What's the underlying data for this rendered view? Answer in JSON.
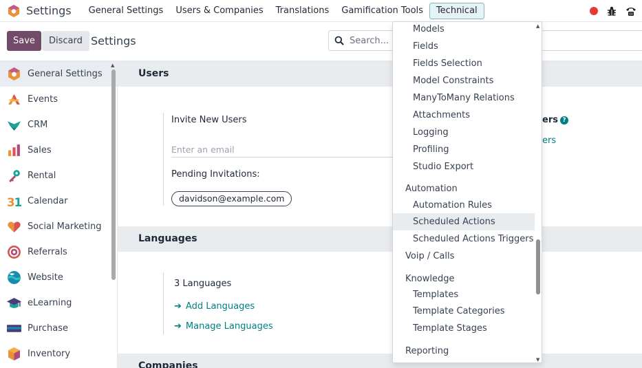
{
  "navbar": {
    "app_title": "Settings",
    "menus": [
      {
        "label": "General Settings"
      },
      {
        "label": "Users & Companies"
      },
      {
        "label": "Translations"
      },
      {
        "label": "Gamification Tools"
      },
      {
        "label": "Technical"
      }
    ],
    "active_menu": "Technical"
  },
  "control": {
    "save_label": "Save",
    "discard_label": "Discard",
    "title": "Settings",
    "search_placeholder": "Search..."
  },
  "sidebar": {
    "items": [
      {
        "label": "General Settings",
        "icon": "odoo-logo-icon"
      },
      {
        "label": "Events",
        "icon": "events-icon"
      },
      {
        "label": "CRM",
        "icon": "crm-icon"
      },
      {
        "label": "Sales",
        "icon": "sales-icon"
      },
      {
        "label": "Rental",
        "icon": "rental-icon"
      },
      {
        "label": "Calendar",
        "icon": "calendar-icon"
      },
      {
        "label": "Social Marketing",
        "icon": "social-marketing-icon"
      },
      {
        "label": "Referrals",
        "icon": "referrals-icon"
      },
      {
        "label": "Website",
        "icon": "website-icon"
      },
      {
        "label": "eLearning",
        "icon": "elearning-icon"
      },
      {
        "label": "Purchase",
        "icon": "purchase-icon"
      },
      {
        "label": "Inventory",
        "icon": "inventory-icon"
      }
    ]
  },
  "main": {
    "users_section": "Users",
    "invite_label": "Invite New Users",
    "email_placeholder": "Enter an email",
    "pending_label": "Pending Invitations:",
    "pending_chip": "davidson@example.com",
    "right_partial_text": "ers",
    "right_partial_link": "ers",
    "languages_section": "Languages",
    "languages_count": "3 Languages",
    "add_languages": "Add Languages",
    "manage_languages": "Manage Languages",
    "companies_section": "Companies"
  },
  "dropdown": {
    "items": [
      {
        "label": "Models",
        "kind": "item"
      },
      {
        "label": "Fields",
        "kind": "item"
      },
      {
        "label": "Fields Selection",
        "kind": "item"
      },
      {
        "label": "Model Constraints",
        "kind": "item"
      },
      {
        "label": "ManyToMany Relations",
        "kind": "item"
      },
      {
        "label": "Attachments",
        "kind": "item"
      },
      {
        "label": "Logging",
        "kind": "item"
      },
      {
        "label": "Profiling",
        "kind": "item"
      },
      {
        "label": "Studio Export",
        "kind": "item"
      },
      {
        "label": "Automation",
        "kind": "header"
      },
      {
        "label": "Automation Rules",
        "kind": "item"
      },
      {
        "label": "Scheduled Actions",
        "kind": "item",
        "hover": true
      },
      {
        "label": "Scheduled Actions Triggers",
        "kind": "item"
      },
      {
        "label": "Voip / Calls",
        "kind": "header"
      },
      {
        "label": "Knowledge",
        "kind": "header"
      },
      {
        "label": "Templates",
        "kind": "item"
      },
      {
        "label": "Template Categories",
        "kind": "item"
      },
      {
        "label": "Template Stages",
        "kind": "item"
      },
      {
        "label": "Reporting",
        "kind": "header"
      }
    ]
  },
  "colors": {
    "brand": "#714b67",
    "link": "#017e84",
    "record": "#e53935"
  }
}
